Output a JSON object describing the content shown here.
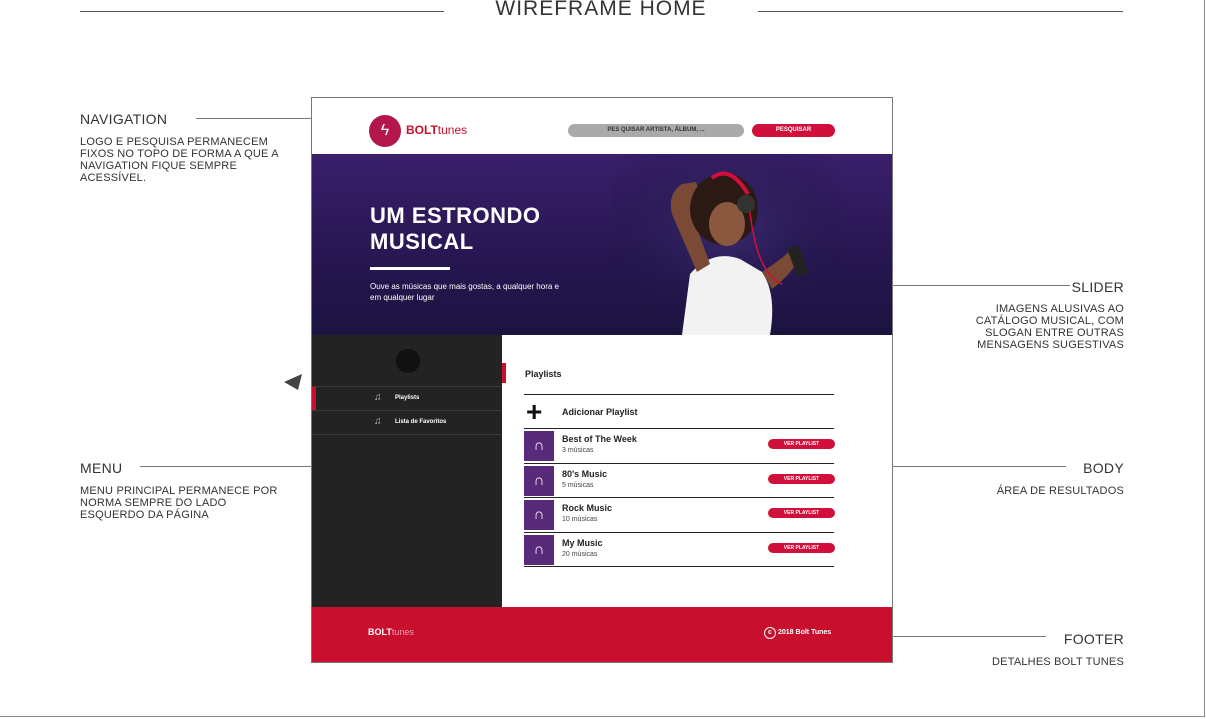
{
  "page_title": "WIREFRAME HOME",
  "annotations": {
    "navigation": {
      "title": "NAVIGATION",
      "desc": "LOGO E PESQUISA PERMANECEM FIXOS NO TOPO DE FORMA A QUE A NAVIGATION FIQUE SEMPRE ACESSÍVEL."
    },
    "slider": {
      "title": "SLIDER",
      "desc": "IMAGENS ALUSIVAS AO CATÁLOGO MUSICAL, COM SLOGAN ENTRE OUTRAS MENSAGENS SUGESTIVAS"
    },
    "menu": {
      "title": "MENU",
      "desc": "MENU PRINCIPAL PERMANECE POR NORMA SEMPRE DO LADO ESQUERDO DA PÁGINA"
    },
    "body": {
      "title": "BODY",
      "desc": "ÁREA DE RESULTADOS"
    },
    "footer": {
      "title": "FOOTER",
      "desc": "DETALHES BOLT TUNES"
    }
  },
  "mockup": {
    "nav": {
      "logo_bold": "BOLT",
      "logo_light": "tunes",
      "search_placeholder": "PES QUISAR ARTISTA, ÁLBUM, ...",
      "search_button": "PESQUISAR"
    },
    "slider": {
      "heading": "UM ESTRONDO MUSICAL",
      "subtitle": "Ouve as músicas que mais gostas, a qualquer hora e em qualquer lugar"
    },
    "menu": {
      "items": [
        {
          "label": "Playlists"
        },
        {
          "label": "Lista de Favoritos"
        }
      ]
    },
    "body": {
      "section_title": "Playlists",
      "add_label": "Adicionar Playlist",
      "playlists": [
        {
          "name": "Best of The Week",
          "count": "3 músicas",
          "button": "VER PLAYLIST"
        },
        {
          "name": "80's Music",
          "count": "5 músicas",
          "button": "VER PLAYLIST"
        },
        {
          "name": "Rock Music",
          "count": "10 músicas",
          "button": "VER PLAYLIST"
        },
        {
          "name": "My Music",
          "count": "20 músicas",
          "button": "VER PLAYLIST"
        }
      ]
    },
    "footer": {
      "logo_bold": "BOLT",
      "logo_light": "tunes",
      "copyright": "2018 Bolt Tunes"
    }
  },
  "icons": [
    "bolt-logo-icon",
    "music-note-icon",
    "headphones-icon",
    "plus-icon",
    "copyright-icon",
    "cursor-arrow-icon"
  ],
  "colors": {
    "accent": "#c8102e",
    "slider_bg": "#2a1a5a",
    "menu_bg": "#232323",
    "playlist_icon_bg": "#5a2a7a"
  }
}
